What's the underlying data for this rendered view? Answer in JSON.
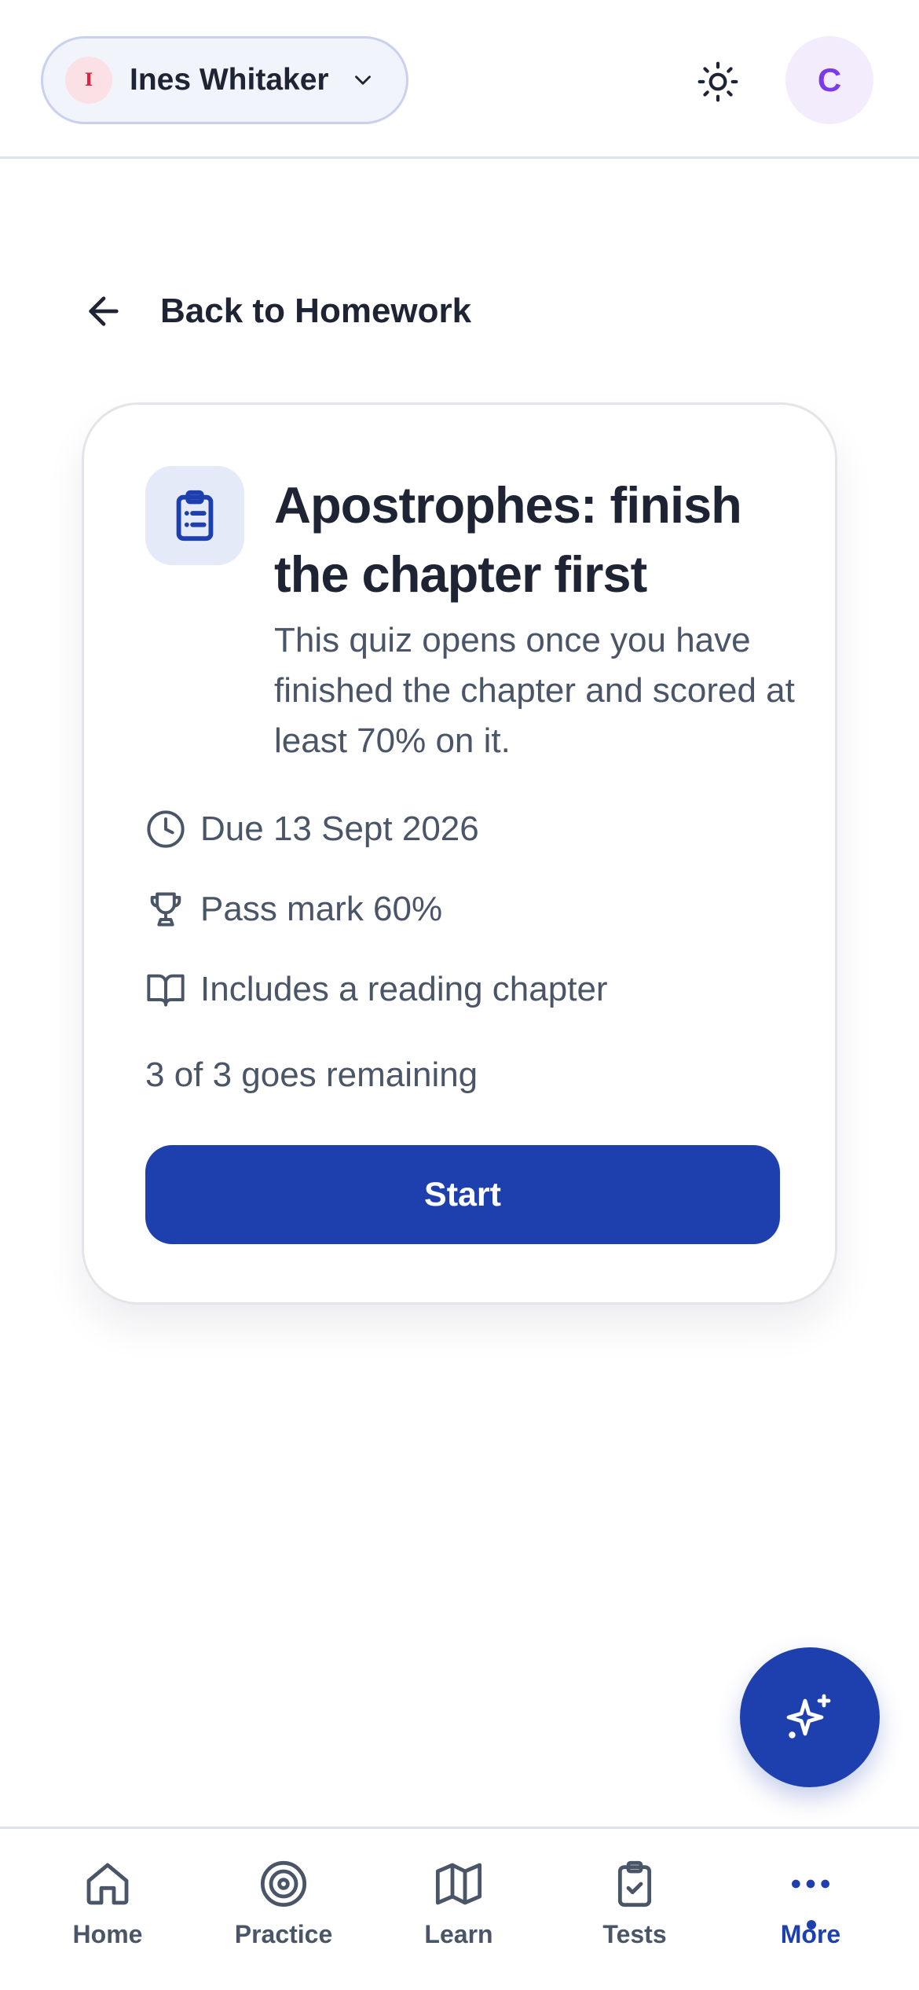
{
  "header": {
    "user_initial": "I",
    "user_name": "Ines Whitaker",
    "avatar_initial": "C",
    "icons": {
      "dropdown": "chevron-down-icon",
      "theme": "sun-icon"
    }
  },
  "back_link": {
    "label": "Back to Homework",
    "icon": "arrow-left-icon"
  },
  "quiz_card": {
    "icon": "clipboard-list-icon",
    "title": "Apostrophes: finish the chapter first",
    "description": "This quiz opens once you have finished the chapter and scored at least 70% on it.",
    "due": "Due 13 Sept 2026",
    "pass_mark": "Pass mark 60%",
    "reading": "Includes a reading chapter",
    "goes_remaining": "3 of 3 goes remaining",
    "start_label": "Start"
  },
  "fab": {
    "icon": "sparkles-icon"
  },
  "bottom_nav": {
    "items": [
      {
        "label": "Home",
        "icon": "home-icon"
      },
      {
        "label": "Practice",
        "icon": "target-icon"
      },
      {
        "label": "Learn",
        "icon": "map-icon"
      },
      {
        "label": "Tests",
        "icon": "clipboard-check-icon"
      },
      {
        "label": "More",
        "icon": "more-dots-icon",
        "active": true
      }
    ]
  },
  "colors": {
    "primary": "#1e40af",
    "text": "#1e2433",
    "muted": "#4a5568",
    "avatar_bg": "#f3ecfd",
    "avatar_text": "#7c3aed",
    "user_initial_text": "#e0223f"
  }
}
